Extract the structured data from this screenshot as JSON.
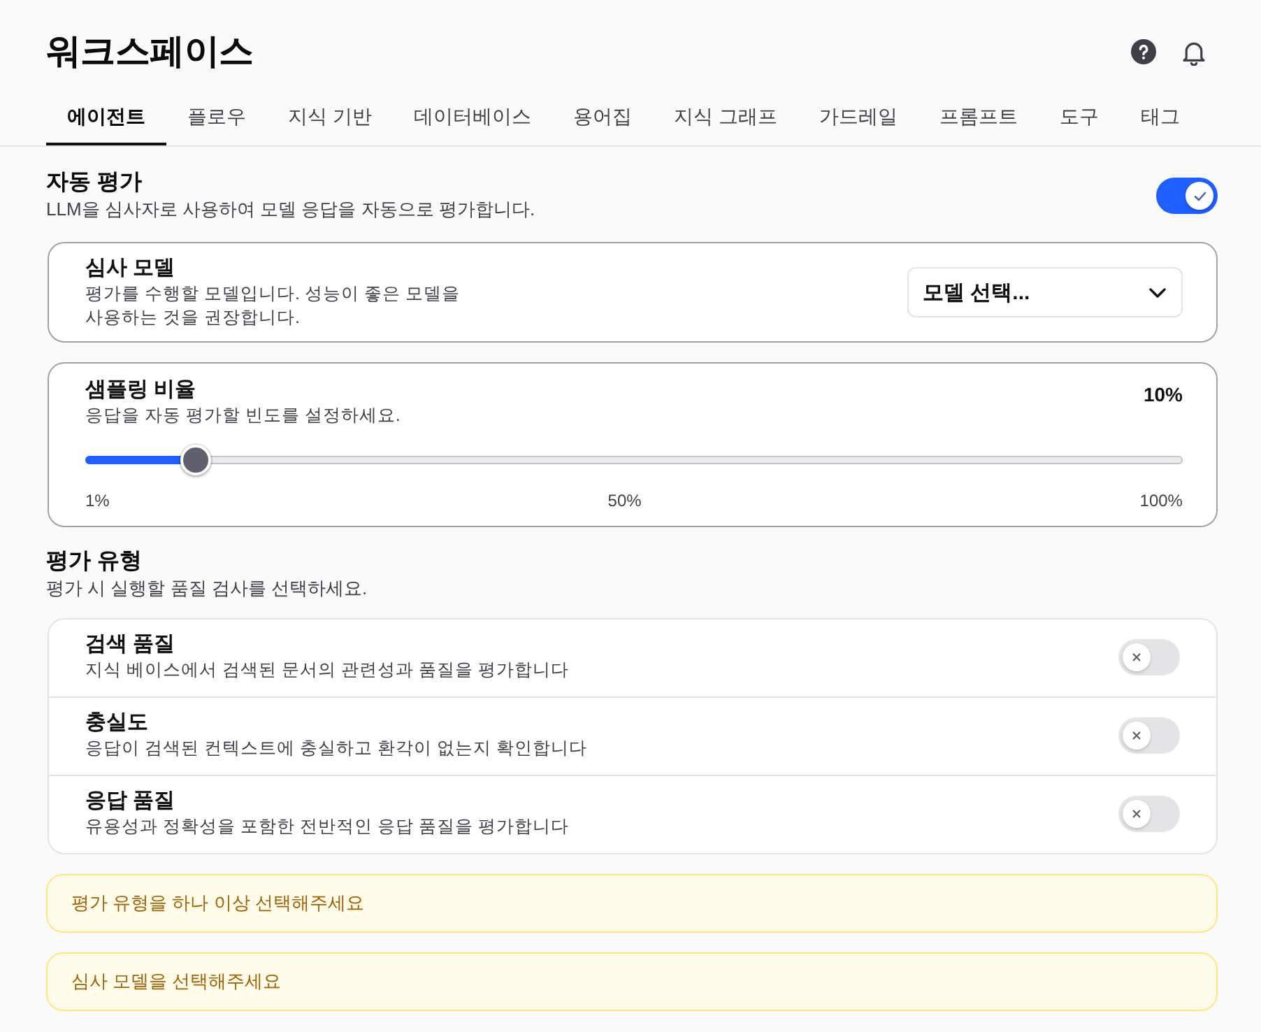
{
  "header": {
    "title": "워크스페이스"
  },
  "tabs": [
    {
      "label": "에이전트",
      "selected": true
    },
    {
      "label": "플로우",
      "selected": false
    },
    {
      "label": "지식 기반",
      "selected": false
    },
    {
      "label": "데이터베이스",
      "selected": false
    },
    {
      "label": "용어집",
      "selected": false
    },
    {
      "label": "지식 그래프",
      "selected": false
    },
    {
      "label": "가드레일",
      "selected": false
    },
    {
      "label": "프롬프트",
      "selected": false
    },
    {
      "label": "도구",
      "selected": false
    },
    {
      "label": "태그",
      "selected": false
    }
  ],
  "auto_eval": {
    "title": "자동 평가",
    "description": "LLM을 심사자로 사용하여 모델 응답을 자동으로 평가합니다.",
    "on": true
  },
  "judge_model": {
    "title": "심사 모델",
    "description": "평가를 수행할 모델입니다. 성능이 좋은 모델을 사용하는 것을 권장합니다.",
    "select": {
      "placeholder": "모델 선택..."
    }
  },
  "sampling": {
    "title": "샘플링 비율",
    "description": "응답을 자동 평가할 빈도를 설정하세요.",
    "reading": "10%",
    "level": 0.1,
    "ticks": [
      "1%",
      "50%",
      "100%"
    ]
  },
  "eval_types": {
    "title": "평가 유형",
    "description": "평가 시 실행할 품질 검사를 선택하세요.",
    "items": [
      {
        "title": "검색 품질",
        "description": "지식 베이스에서 검색된 문서의 관련성과 품질을 평가합니다",
        "on": false
      },
      {
        "title": "충실도",
        "description": "응답이 검색된 컨텍스트에 충실하고 환각이 없는지 확인합니다",
        "on": false
      },
      {
        "title": "응답 품질",
        "description": "유용성과 정확성을 포함한 전반적인 응답 품질을 평가합니다",
        "on": false
      }
    ]
  },
  "alerts": [
    {
      "text": "평가 유형을 하나 이상 선택해주세요"
    },
    {
      "text": "심사 모델을 선택해주세요"
    }
  ]
}
